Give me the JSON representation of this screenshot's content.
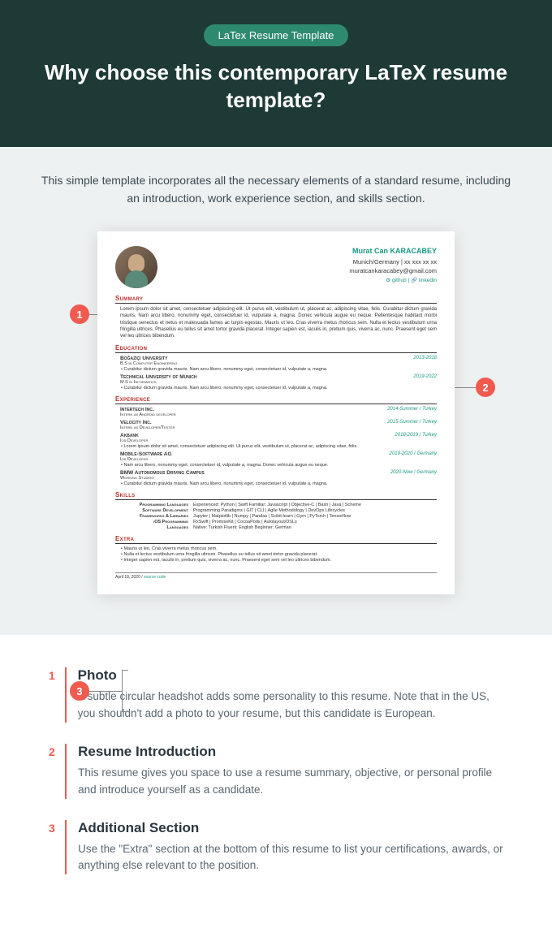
{
  "hero": {
    "badge": "LaTex Resume Template",
    "title": "Why choose this contemporary LaTeX resume template?"
  },
  "intro": "This simple template incorporates all the necessary elements of a standard resume, including an introduction, work experience section, and skills section.",
  "resume": {
    "name": "Murat Can KARACABEY",
    "location": "Munich/Germany",
    "phone": "xx xxx xx xx",
    "email": "muratcankaracabey@gmail.com",
    "link1": "github",
    "link2": "linkedin",
    "sect_summary": "Summary",
    "summary_body": "Lorem ipsum dolor sit amet, consectetuer adipiscing elit. Ut purus elit, vestibulum ut, placerat ac, adipiscing vitae, felis. Curabitur dictum gravida mauris. Nam arcu libero, nonummy eget, consectetuer id, vulputate a, magna. Donec vehicula augue eu neque. Pellentesque habitant morbi tristique senectus et netus et malesuada fames ac turpis egestas. Mauris ut leo. Cras viverra metus rhoncus sem. Nulla et lectus vestibulum urna fringilla ultrices. Phasellus eu tellus sit amet tortor gravida placerat. Integer sapien est, iaculis in, pretium quis, viverra ac, nunc. Praesent eget sem vel leo ultrices bibendum.",
    "sect_education": "Education",
    "edu1_title": "Boğaziçi University",
    "edu1_date": "2013-2018",
    "edu1_sub": "B.S in Computer Engineering",
    "edu1_bullet": "Curabitur dictum gravida mauris. Nam arcu libero, nonummy eget, consectetuer id, vulputate a, magna.",
    "edu2_title": "Technical University of Munich",
    "edu2_date": "2019-2022",
    "edu2_sub": "M.S in Informatics",
    "edu2_bullet": "Curabitur dictum gravida mauris. Nam arcu libero, nonummy eget, consectetuer id, vulputate a, magna.",
    "sect_experience": "Experience",
    "exp1_title": "Intertech Inc.",
    "exp1_date": "2014-Summer / Turkey",
    "exp1_sub": "Intern as Android developer",
    "exp2_title": "Velocity Inc.",
    "exp2_date": "2015-Summer / Turkey",
    "exp2_sub": "Intern as Developer/Tester",
    "exp3_title": "Akbank",
    "exp3_date": "2018-2019 / Turkey",
    "exp3_sub": "Ios Developer",
    "exp3_bullet": "Lorem ipsum dolor sit amet, consectetuer adipiscing elit. Ut purus elit, vestibulum ut, placerat ac, adipiscing vitae, felis.",
    "exp4_title": "Mobile-Software AG",
    "exp4_date": "2019-2020 / Germany",
    "exp4_sub": "Ios Developer",
    "exp4_bullet": "Nam arcu libero, nonummy eget, consectetuer id, vulputate a, magna. Donec vehicula augue eu neque.",
    "exp5_title": "BMW Autonomous Driving Campus",
    "exp5_date": "2020-Now / Germany",
    "exp5_sub": "Working Student",
    "exp5_bullet": "Curabitur dictum gravida mauris. Nam arcu libero, nonummy eget, consectetuer id, vulputate a, magna.",
    "sect_skills": "Skills",
    "sk1_label": "Programming Languages",
    "sk1_val": "Experienced: Python | Swift Familiar: Javascript | Objective-C | Bash | Java | Scheme",
    "sk2_label": "Software Development",
    "sk2_val": "Programming Paradigms | GIT | CLI | Agile Methodology | DevOps Lifecycles",
    "sk3_label": "Frameworks & Libraries",
    "sk3_val": "Jupyter | Matplotlib | Numpy | Pandas | Scikit-learn | Gym | PyTorch | Tensorflow",
    "sk4_label": "iOS Programming",
    "sk4_val": "RxSwift | PromiseKit | CocoaPods | Autolayout/DSLs",
    "sk5_label": "Languages",
    "sk5_val": "Native: Turkish Fluent: English Beginner: German",
    "sect_extra": "Extra",
    "ex1": "Mauris ut leo. Cras viverra metus rhoncus sem.",
    "ex2": "Nulla et lectus vestibulum urna fringilla ultrices. Phasellus eu tellus sit amet tortor gravida placerat.",
    "ex3": "Integer sapien est, iaculis in, pretium quis, viverra ac, nunc. Praesent eget sem vel leo ultrices bibendum.",
    "footer_date": "April 18, 2020 / ",
    "footer_link": "source code"
  },
  "callouts": {
    "c1": "1",
    "c2": "2",
    "c3": "3"
  },
  "features": [
    {
      "num": "1",
      "title": "Photo",
      "desc": "A subtle circular headshot adds some personality to this resume. Note that in the US, you shouldn't add a photo to your resume, but this candidate is European."
    },
    {
      "num": "2",
      "title": "Resume Introduction",
      "desc": "This resume gives you space to use a resume summary, objective, or personal profile and introduce yourself as a candidate."
    },
    {
      "num": "3",
      "title": "Additional Section",
      "desc": "Use the \"Extra\" section at the bottom of this resume to list your certifications, awards, or anything else relevant to the position."
    }
  ]
}
